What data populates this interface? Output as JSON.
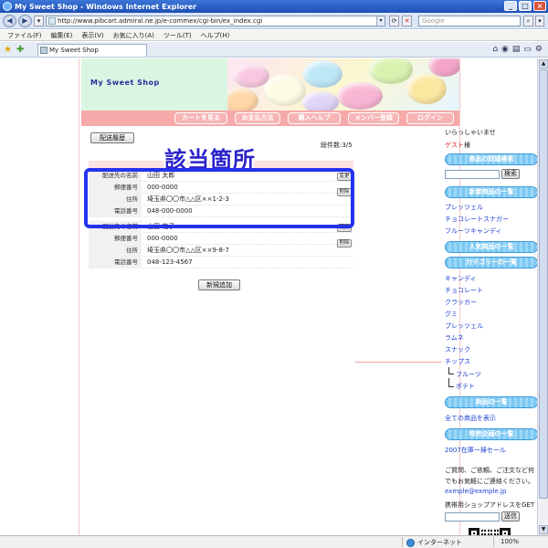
{
  "window": {
    "title": "My Sweet Shop - Windows Internet Explorer",
    "url": "http://www.pibcart.admiral.ne.jp/e-commex/cgi-bin/ex_index.cgi",
    "search_placeholder": "Google",
    "menu": [
      "ファイル(F)",
      "編集(E)",
      "表示(V)",
      "お気に入り(A)",
      "ツール(T)",
      "ヘルプ(H)"
    ],
    "tab_title": "My Sweet Shop"
  },
  "status": {
    "zone": "インターネット",
    "zoom": "100%"
  },
  "shop": {
    "logo": "My Sweet Shop",
    "nav": [
      "カートを見る",
      "お支払方法",
      "購入ヘルプ",
      "メンバー登録",
      "ログイン"
    ]
  },
  "main": {
    "history_button": "配送履歴",
    "total": "総件数:3/5",
    "annotation": "該当箇所",
    "add_button": "新規追加",
    "change_label": "変更",
    "delete_label": "削除",
    "field_labels": {
      "name": "配送先の名前",
      "zip": "郵便番号",
      "address": "住所",
      "phone": "電話番号"
    },
    "addresses": [
      {
        "name": "山田 太郎",
        "zip": "000-0000",
        "address": "埼玉県〇〇市△△区××1-2-3",
        "phone": "048-000-0000"
      },
      {
        "name": "山田 花子",
        "zip": "000-0000",
        "address": "埼玉県〇〇市△△区××9-8-7",
        "phone": "048-123-4567"
      }
    ]
  },
  "sidebar": {
    "greeting": "いらっしゃいませ",
    "guest": "ゲスト",
    "guest_suffix": "様",
    "search_title": "商品の詳細検索",
    "search_button": "検索",
    "new_title": "新着商品の一覧",
    "new_items": [
      "プレッツェル",
      "チョコレートスナガー",
      "フルーツキャンディ"
    ],
    "popular_title": "人気商品の一覧",
    "category_title": "カテゴリーの一覧",
    "categories": [
      "キャンディ",
      "チョコレート",
      "クラッカー",
      "グミ",
      "プレッツェル",
      "ラムネ",
      "スナック",
      "チップス"
    ],
    "subcategories": [
      "フルーツ",
      "ポテト"
    ],
    "products_title": "商品の一覧",
    "all_products": "全ての商品を表示",
    "special_title": "特売企画の一覧",
    "special_item": "2007在庫一掃セール",
    "contact_text_1": "ご質問、ご依頼、ご注文など何",
    "contact_text_2": "でもお気軽にご連絡ください。",
    "contact_email": "exmple@exmple.jp",
    "mobile_text": "携帯用ショップアドレスをGET",
    "send_button": "送信"
  }
}
